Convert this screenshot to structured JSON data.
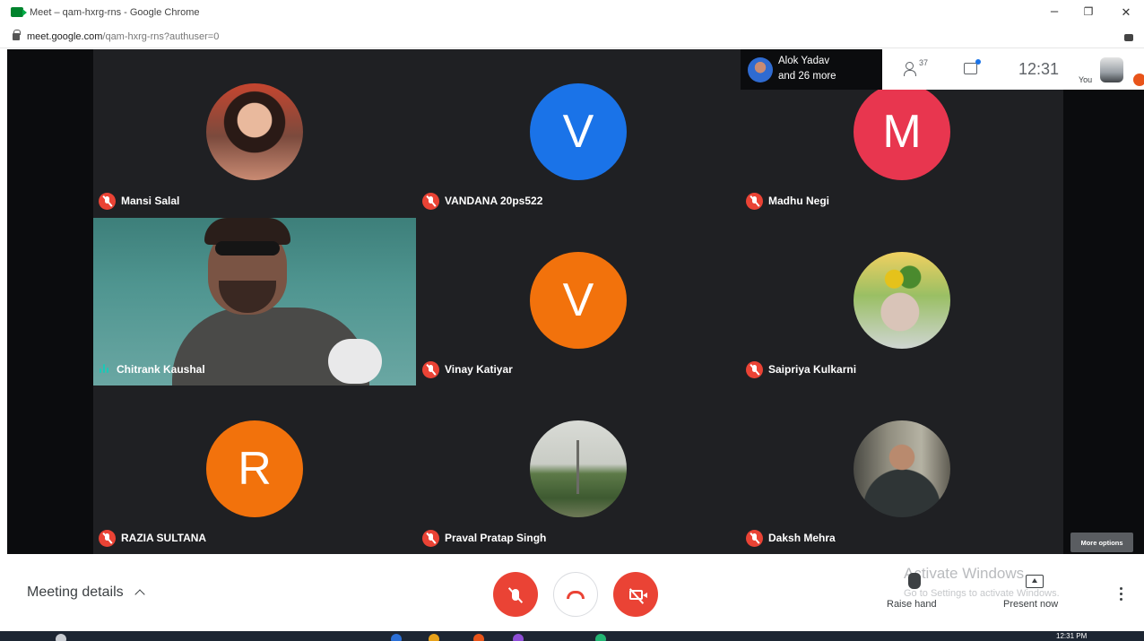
{
  "browser": {
    "tab_title": "Meet – qam-hxrg-rns - Google Chrome",
    "url_host": "meet.google.com",
    "url_path": "/qam-hxrg-rns?authuser=0",
    "minimize_glyph": "–",
    "restore_glyph": "❐",
    "close_glyph": "✕"
  },
  "presence": {
    "line1": "Alok Yadav",
    "line2": "and 26 more"
  },
  "topbar": {
    "participant_count": "37",
    "time": "12:31",
    "self_label": "You"
  },
  "participants": [
    {
      "name": "Mansi Salal",
      "avatar_type": "photo",
      "muted": true
    },
    {
      "name": "VANDANA 20ps522",
      "avatar_type": "letter",
      "letter": "V",
      "color": "#1a73e8",
      "muted": true
    },
    {
      "name": "Madhu Negi",
      "avatar_type": "letter",
      "letter": "M",
      "color": "#e8364f",
      "muted": true
    },
    {
      "name": "Chitrank Kaushal",
      "avatar_type": "video",
      "speaking": true
    },
    {
      "name": "Vinay Katiyar",
      "avatar_type": "letter",
      "letter": "V",
      "color": "#f2720c",
      "muted": true
    },
    {
      "name": "Saipriya Kulkarni",
      "avatar_type": "photo",
      "muted": true
    },
    {
      "name": "RAZIA SULTANA",
      "avatar_type": "letter",
      "letter": "R",
      "color": "#f2720c",
      "muted": true
    },
    {
      "name": "Praval Pratap Singh",
      "avatar_type": "photo",
      "muted": true
    },
    {
      "name": "Daksh Mehra",
      "avatar_type": "photo",
      "muted": true
    }
  ],
  "more_options_label": "More options",
  "bottombar": {
    "meeting_details": "Meeting details",
    "raise_hand": "Raise hand",
    "present_now": "Present now"
  },
  "watermark": {
    "title": "Activate Windows",
    "subtitle": "Go to Settings to activate Windows."
  },
  "taskbar": {
    "time": "12:31 PM"
  },
  "colors": {
    "stage_bg": "#1f2023",
    "muted_red": "#ea4335",
    "speaking_teal": "#1ac9b8",
    "letter_blue": "#1a73e8",
    "letter_pink": "#e8364f",
    "letter_orange": "#f2720c"
  }
}
